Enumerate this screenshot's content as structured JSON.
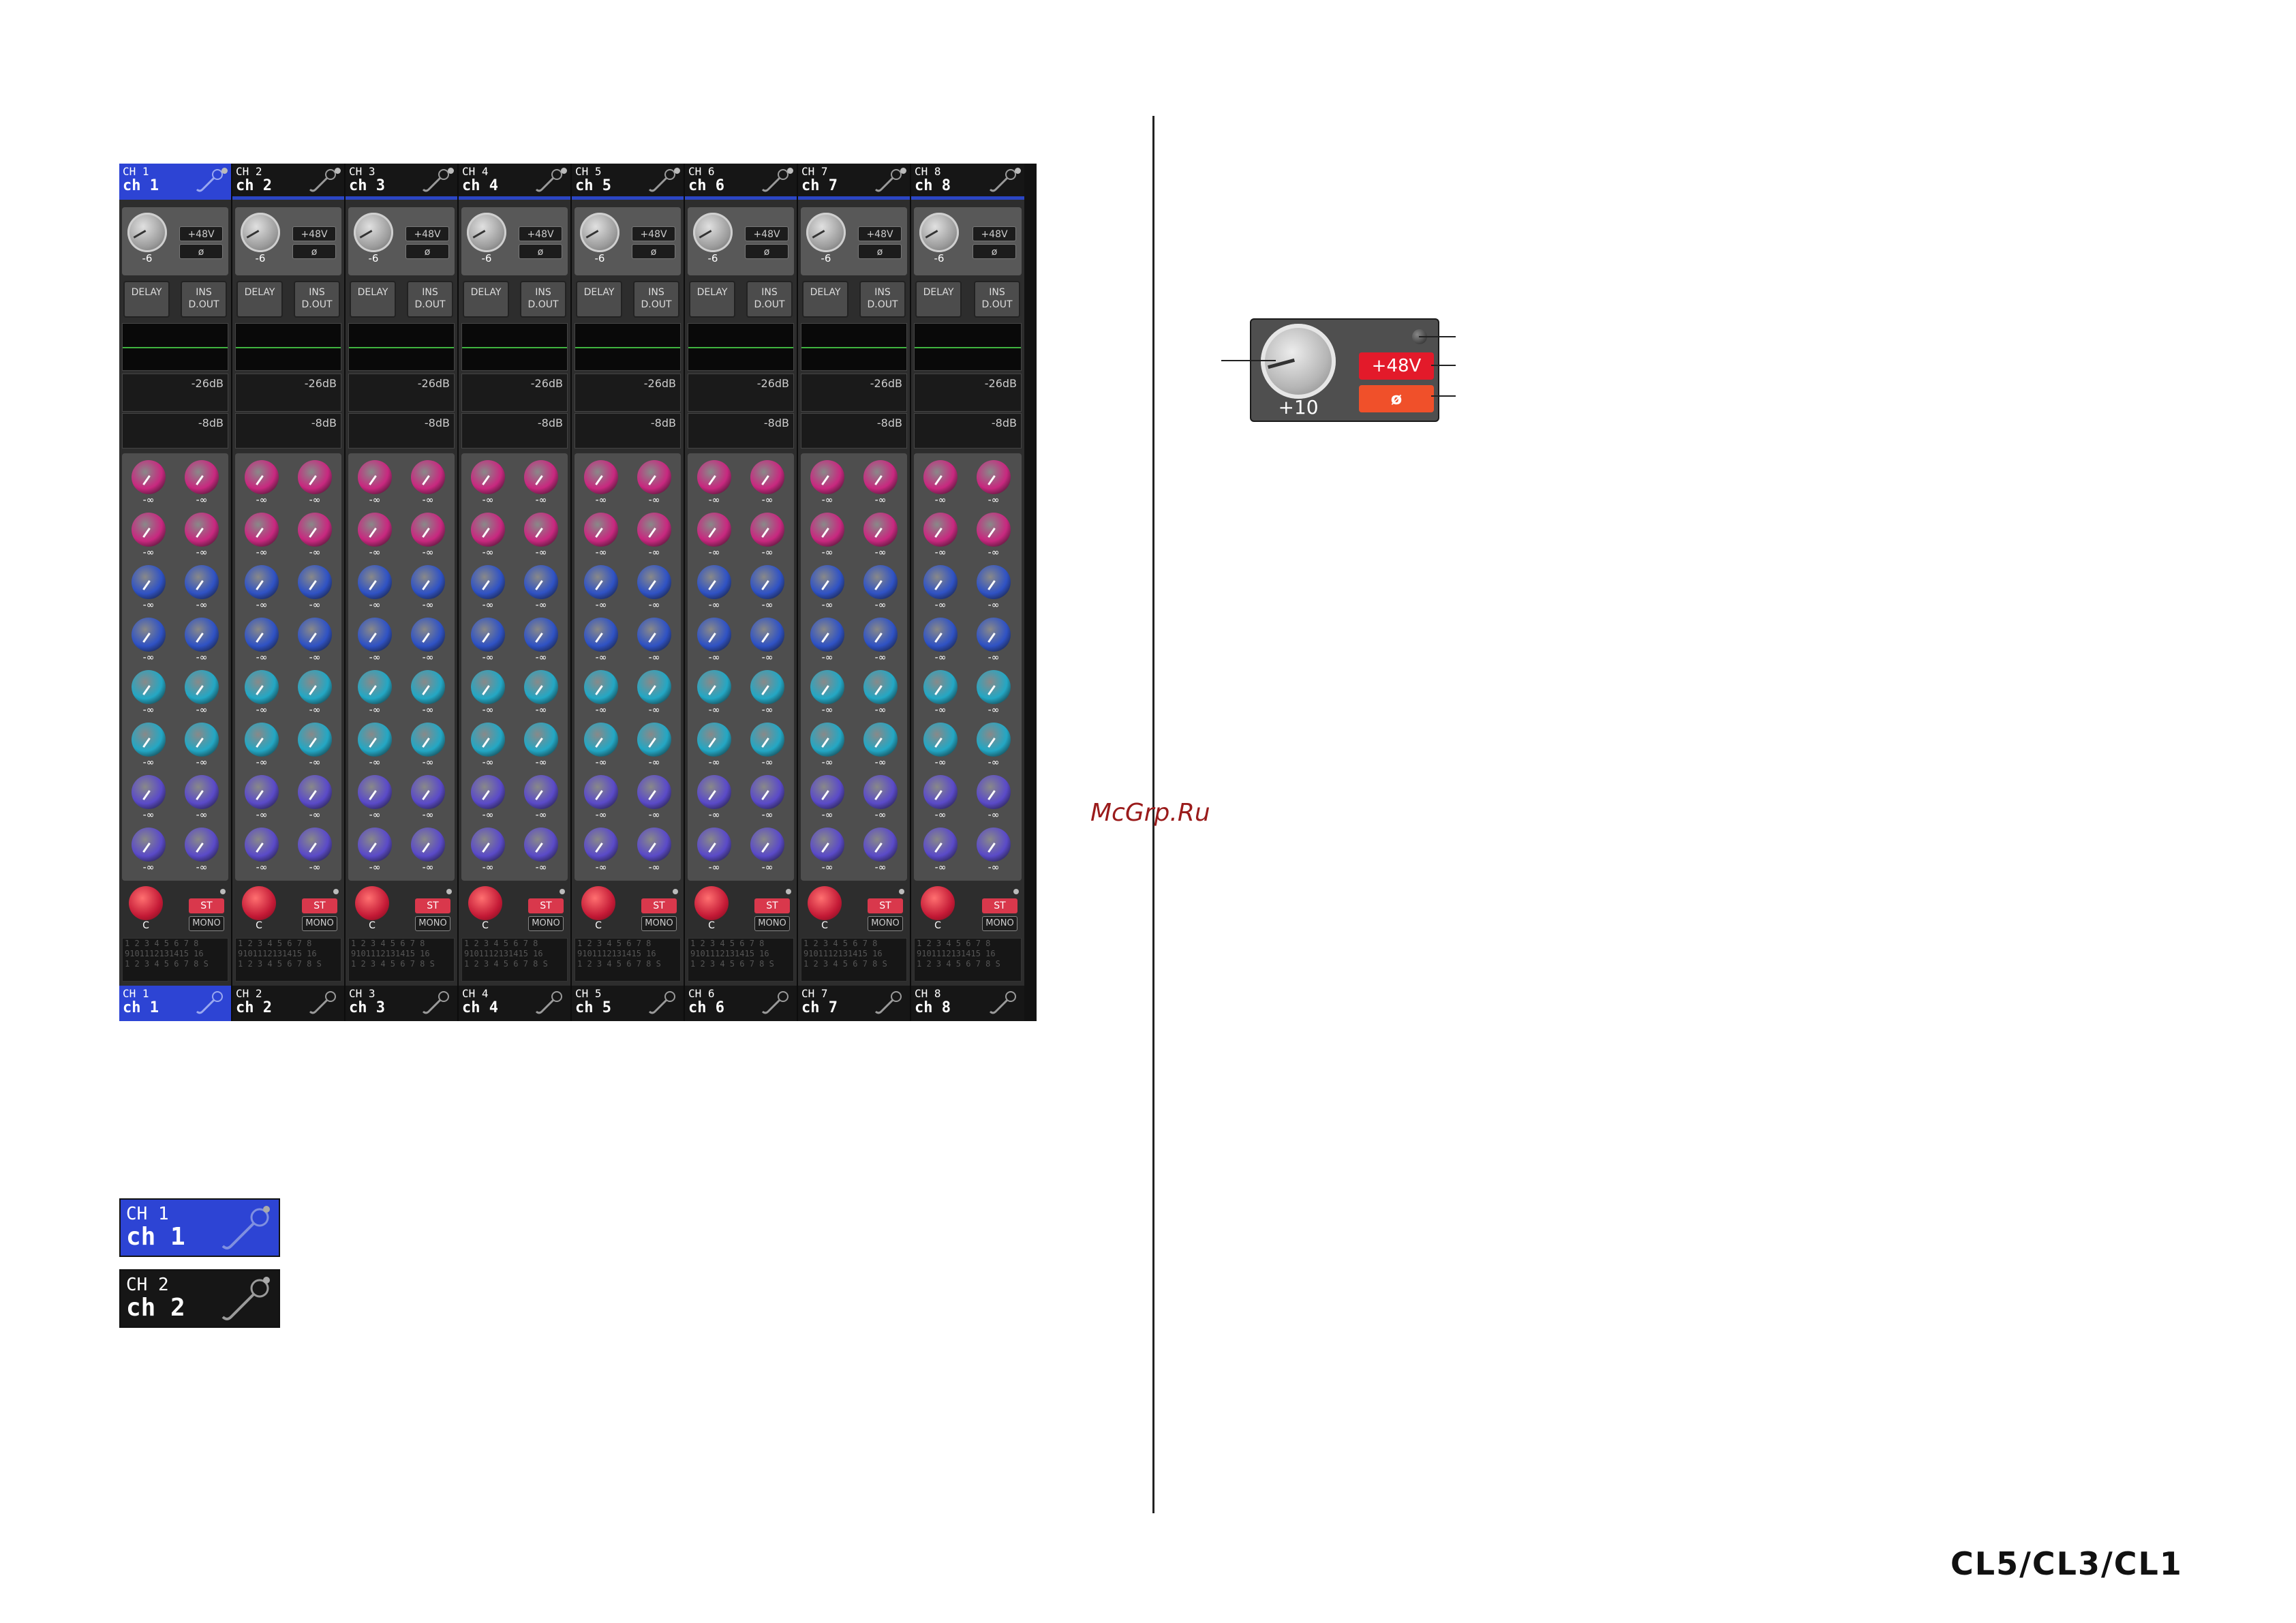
{
  "channels": [
    {
      "number": "CH 1",
      "name": "ch 1",
      "selected": true
    },
    {
      "number": "CH 2",
      "name": "ch 2",
      "selected": false
    },
    {
      "number": "CH 3",
      "name": "ch 3",
      "selected": false
    },
    {
      "number": "CH 4",
      "name": "ch 4",
      "selected": false
    },
    {
      "number": "CH 5",
      "name": "ch 5",
      "selected": false
    },
    {
      "number": "CH 6",
      "name": "ch 6",
      "selected": false
    },
    {
      "number": "CH 7",
      "name": "ch 7",
      "selected": false
    },
    {
      "number": "CH 8",
      "name": "ch 8",
      "selected": false
    }
  ],
  "strip_labels": {
    "gain_value": "-6",
    "phantom": "+48V",
    "phase": "ø",
    "delay": "DELAY",
    "ins": "INS",
    "dout": "D.OUT",
    "gate_level": "-26dB",
    "comp_level": "-8dB",
    "send_value": "-∞",
    "pan_value": "C",
    "st": "ST",
    "mono": "MONO",
    "dca_rows": [
      "1 2 3 4 5 6 7 8",
      "9101112131415 16",
      "1 2 3 4 5 6 7 8 S"
    ]
  },
  "send_colors": [
    "#c8287f",
    "#c8287f",
    "#2f52c4",
    "#2f52c4",
    "#23a7c4",
    "#23a7c4",
    "#5a4ac8",
    "#5a4ac8"
  ],
  "callout": {
    "gain_value": "+10",
    "phantom": "+48V",
    "phase": "ø"
  },
  "examples": [
    {
      "number": "CH 1",
      "name": "ch 1",
      "style": "selected"
    },
    {
      "number": "CH 2",
      "name": "ch 2",
      "style": "normal"
    }
  ],
  "watermark": "McGrp.Ru",
  "logo_text": "CL5/CL3/CL1"
}
